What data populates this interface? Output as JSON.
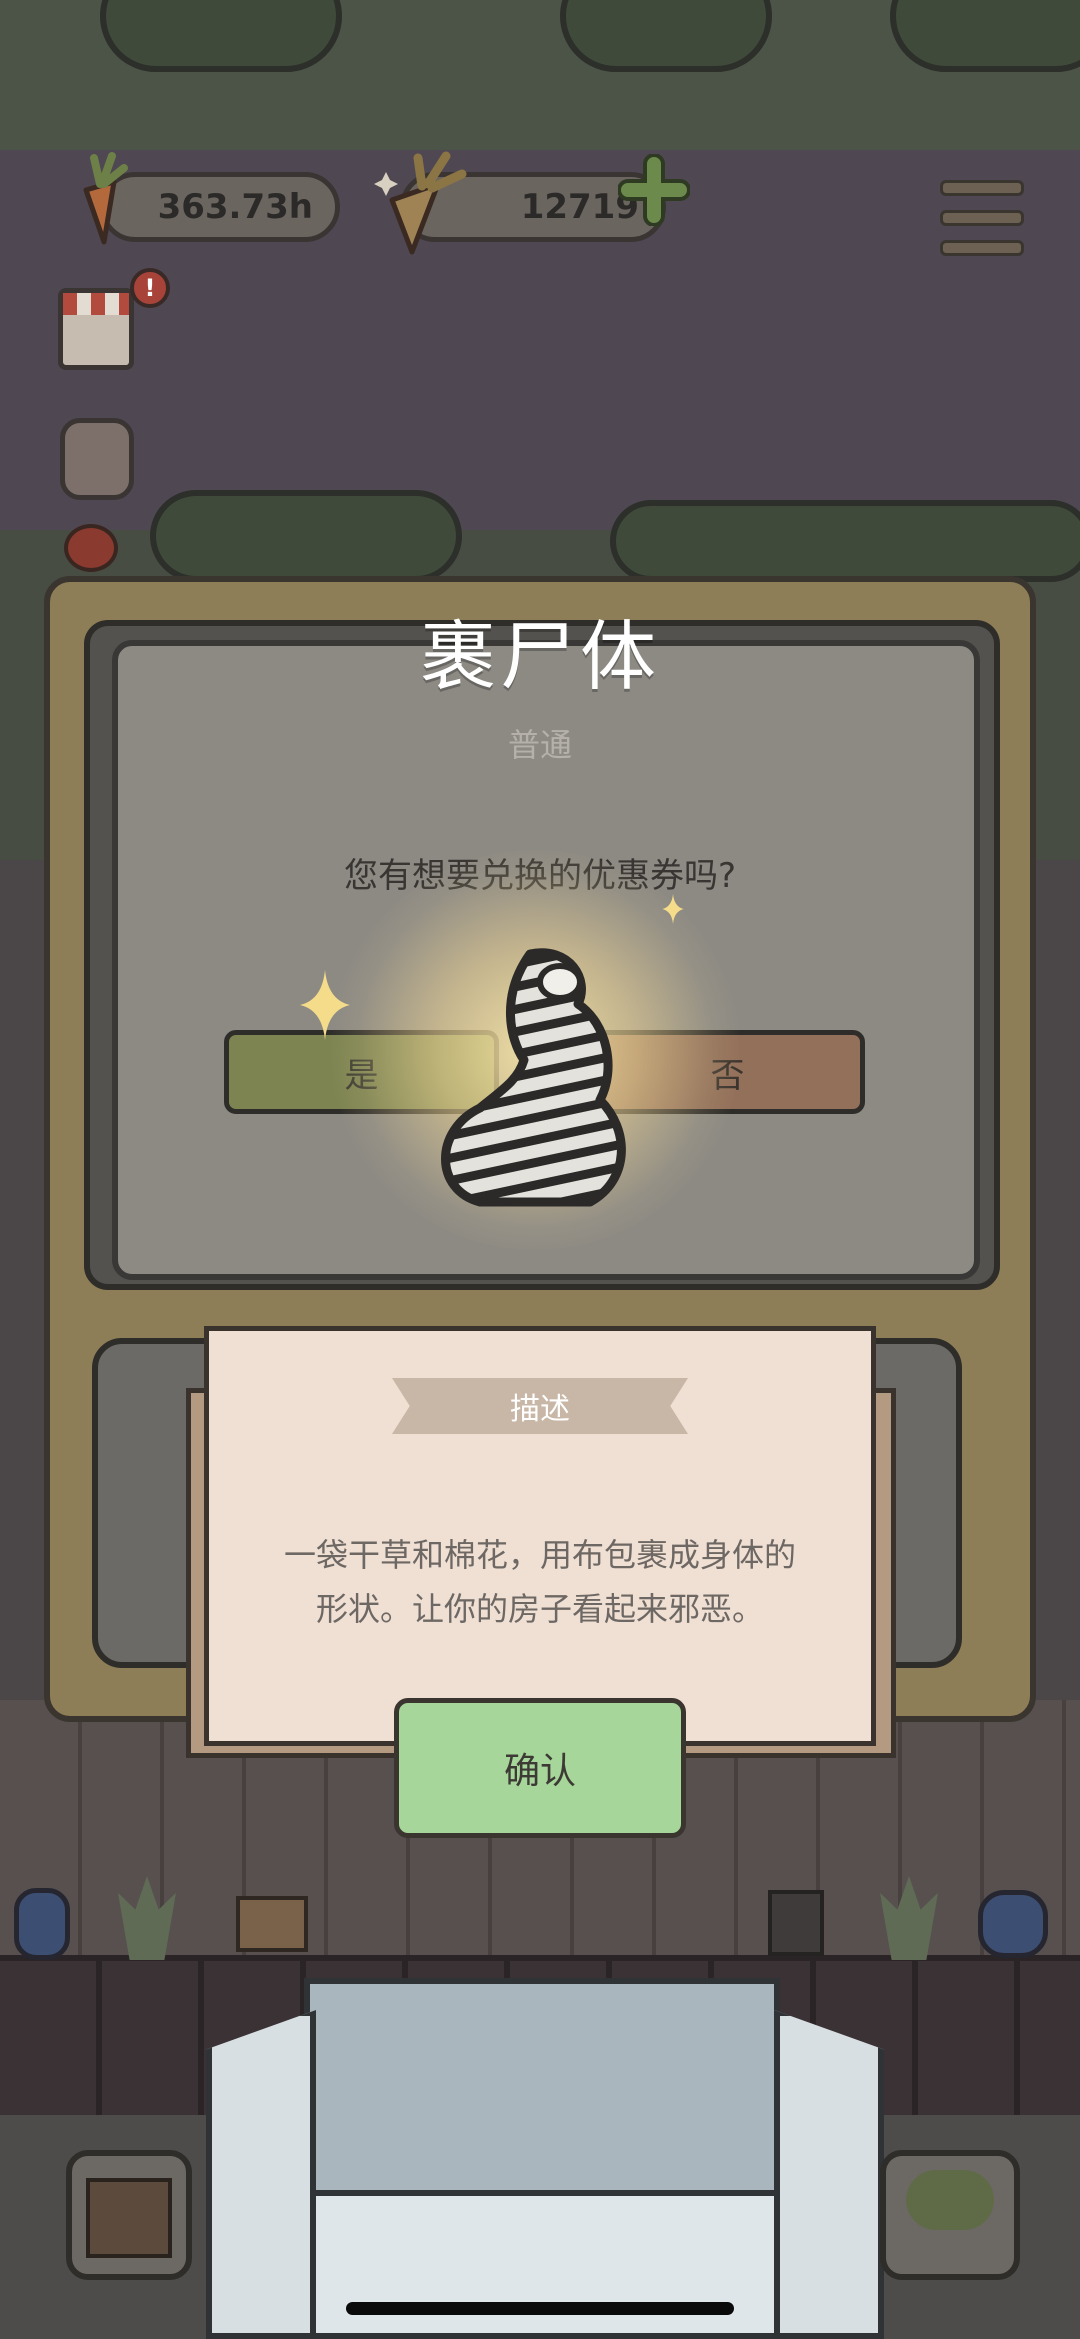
{
  "hud": {
    "carrot_amount": "363.73h",
    "gold_carrot_amount": "12719",
    "add_icon": "plus-icon",
    "menu_icon": "hamburger-menu-icon",
    "shop_alert": "!"
  },
  "dialog": {
    "title": "裹尸体",
    "rarity": "普通",
    "question": "您有想要兑换的优惠券吗?",
    "yes_label": "是",
    "no_label": "否",
    "item_icon": "wrapped-body-icon"
  },
  "description": {
    "header": "描述",
    "text_line1": "一袋干草和棉花，用布包裹成身体的",
    "text_line2": "形状。让你的房子看起来邪恶。"
  },
  "confirm_label": "确认",
  "colors": {
    "yes_button": "#7d8451",
    "no_button": "#93705a",
    "confirm_button": "#a6d699",
    "card": "#f0e0d4"
  }
}
